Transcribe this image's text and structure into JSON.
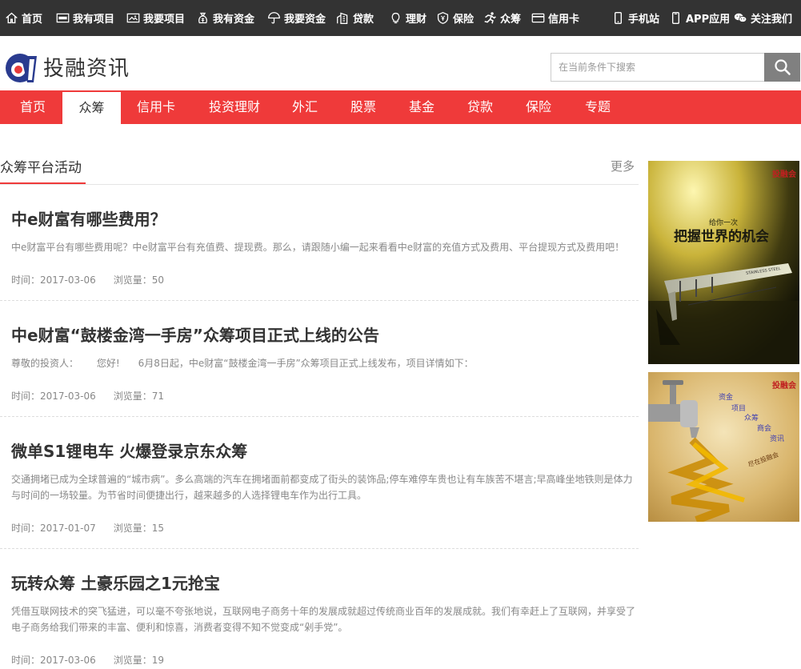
{
  "topbar": {
    "left_items": [
      {
        "label": "首页",
        "icon": "home-icon"
      },
      {
        "label": "我有项目",
        "icon": "project-card-icon"
      },
      {
        "label": "我要项目",
        "icon": "image-card-icon"
      },
      {
        "label": "我有资金",
        "icon": "money-bag-icon"
      },
      {
        "label": "我要资金",
        "icon": "umbrella-icon"
      },
      {
        "label": "贷款",
        "icon": "building-icon"
      },
      {
        "label": "理财",
        "icon": "lightbulb-icon"
      },
      {
        "label": "保险",
        "icon": "shield-yen-icon"
      },
      {
        "label": "众筹",
        "icon": "person-run-icon"
      },
      {
        "label": "信用卡",
        "icon": "credit-card-icon"
      }
    ],
    "right_items": [
      {
        "label": "手机站",
        "icon": "mobile-icon"
      },
      {
        "label": "APP应用",
        "icon": "smartphone-icon"
      },
      {
        "label": "关注我们",
        "icon": "wechat-icon"
      }
    ]
  },
  "header": {
    "site_name": "投融资讯",
    "search_placeholder": "在当前条件下搜索"
  },
  "nav": {
    "items": [
      "首页",
      "众筹",
      "信用卡",
      "投资理财",
      "外汇",
      "股票",
      "基金",
      "贷款",
      "保险",
      "专题"
    ],
    "active": "众筹"
  },
  "section": {
    "title": "众筹平台活动",
    "more": "更多"
  },
  "articles": [
    {
      "title": "中e财富有哪些费用？",
      "summary": "中e财富平台有哪些费用呢？中e财富平台有充值费、提现费。那么，请跟随小编一起来看看中e财富的充值方式及费用、平台提现方式及费用吧！",
      "time": "时间：2017-03-06",
      "views": "浏览量：50"
    },
    {
      "title": "中e财富“鼓楼金湾一手房”众筹项目正式上线的公告",
      "summary": "尊敬的投资人：      您好!      6月8日起，中e财富“鼓楼金湾一手房”众筹项目正式上线发布，项目详情如下：",
      "time": "时间：2017-03-06",
      "views": "浏览量：71"
    },
    {
      "title": "微单S1锂电车 火爆登录京东众筹",
      "summary": "交通拥堵已成为全球普遍的“城市病”。多么高端的汽车在拥堵面前都变成了街头的装饰品;停车难停车贵也让有车族苦不堪言;早高峰坐地铁则是体力与时间的一场较量。为节省时间便捷出行，越来越多的人选择锂电车作为出行工具。",
      "time": "时间：2017-01-07",
      "views": "浏览量：15"
    },
    {
      "title": "玩转众筹 土豪乐园之1元抢宝",
      "summary": "凭借互联网技术的突飞猛进，可以毫不夸张地说，互联网电子商务十年的发展成就超过传统商业百年的发展成就。我们有幸赶上了互联网，并享受了电子商务给我们带来的丰富、便利和惊喜，消费者变得不知不觉变成“剁手党”。",
      "time": "时间：2017-03-06",
      "views": "浏览量：19"
    }
  ],
  "ads": [
    {
      "brand": "投融会",
      "headline_small": "给你一次",
      "headline": "把握世界的机会",
      "ruler_text": "STAINLESS STEEL"
    },
    {
      "brand": "投融会",
      "words": [
        "资金",
        "项目",
        "众筹",
        "商会",
        "资讯"
      ],
      "side_text": "尽在投融会"
    }
  ],
  "colors": {
    "topbar_bg": "#333333",
    "nav_bg": "#ef3a3a",
    "accent_red": "#ef3a3a",
    "logo_blue": "#2a3b8f",
    "text_main": "#333333",
    "text_muted": "#888888"
  }
}
